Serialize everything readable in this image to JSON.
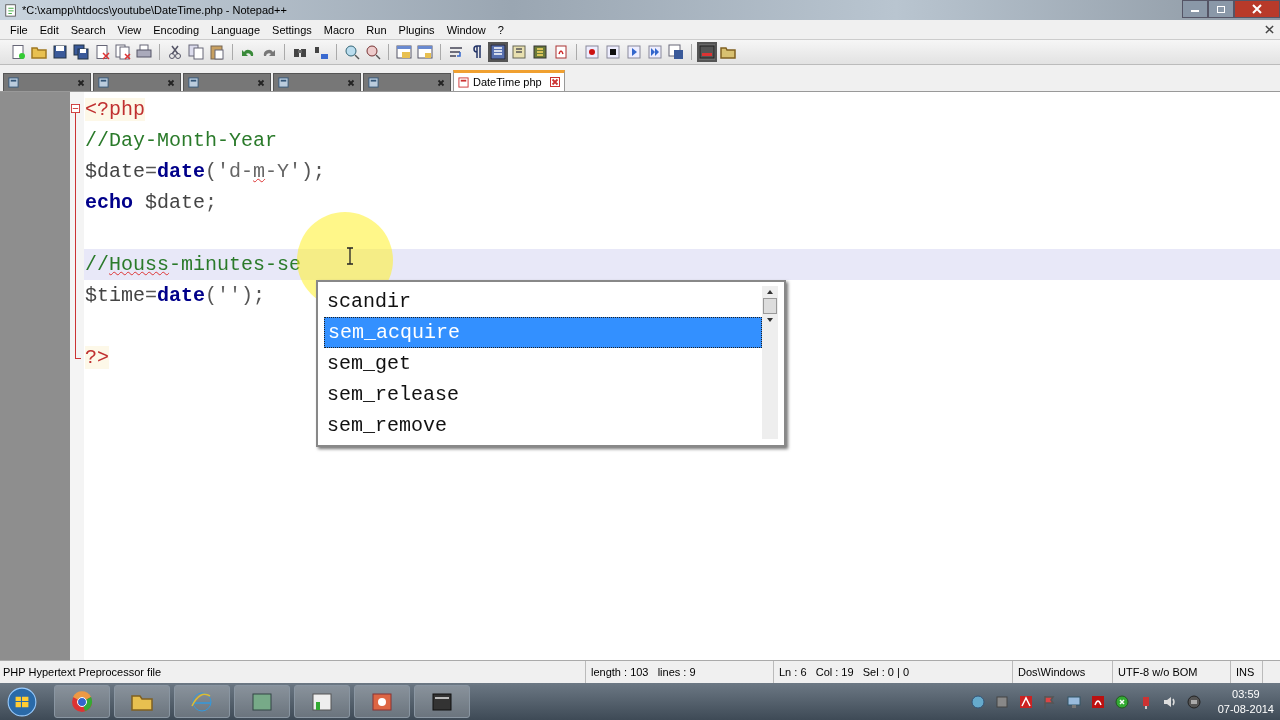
{
  "window": {
    "title": "*C:\\xampp\\htdocs\\youtube\\DateTime.php - Notepad++"
  },
  "menu": [
    "File",
    "Edit",
    "Search",
    "View",
    "Encoding",
    "Language",
    "Settings",
    "Macro",
    "Run",
    "Plugins",
    "Window",
    "?"
  ],
  "tabs": [
    {
      "selected": false
    },
    {
      "selected": false
    },
    {
      "selected": false
    },
    {
      "selected": false
    },
    {
      "selected": false
    },
    {
      "label": "DateTime php",
      "selected": true
    }
  ],
  "lines": [
    {
      "current": false,
      "tokens": [
        {
          "text": "<?php",
          "kind": "tag"
        }
      ]
    },
    {
      "current": false,
      "tokens": [
        {
          "text": "//Day-Month-Year",
          "kind": "comment"
        }
      ]
    },
    {
      "current": false,
      "tokens": [
        {
          "text": "$date",
          "kind": "var"
        },
        {
          "text": "=",
          "kind": "op"
        },
        {
          "text": "date",
          "kind": "func"
        },
        {
          "text": "(",
          "kind": "op"
        },
        {
          "text": "'d-",
          "kind": "string"
        },
        {
          "text": "m",
          "kind": "string",
          "misspelled": true
        },
        {
          "text": "-Y'",
          "kind": "string"
        },
        {
          "text": ");",
          "kind": "op"
        }
      ]
    },
    {
      "current": false,
      "tokens": [
        {
          "text": "echo",
          "kind": "func"
        },
        {
          "text": " $date",
          "kind": "var"
        },
        {
          "text": ";",
          "kind": "op"
        }
      ]
    },
    {
      "current": false
    },
    {
      "current": true,
      "tokens": [
        {
          "text": "//",
          "kind": "comment"
        },
        {
          "text": "Houss",
          "kind": "comment",
          "misspelled": true
        },
        {
          "text": "-minutes-se",
          "kind": "comment"
        }
      ]
    },
    {
      "current": false,
      "tokens": [
        {
          "text": "$time",
          "kind": "var"
        },
        {
          "text": "=",
          "kind": "op"
        },
        {
          "text": "date",
          "kind": "func"
        },
        {
          "text": "(",
          "kind": "op"
        },
        {
          "text": "''",
          "kind": "string"
        },
        {
          "text": ");",
          "kind": "op"
        }
      ]
    },
    {
      "current": false
    },
    {
      "current": false,
      "tokens": [
        {
          "text": "?>",
          "kind": "tag"
        }
      ]
    }
  ],
  "autocomplete": [
    {
      "label": "scandir",
      "selected": false
    },
    {
      "label": "sem_acquire",
      "selected": true
    },
    {
      "label": "sem_get",
      "selected": false
    },
    {
      "label": "sem_release",
      "selected": false
    },
    {
      "label": "sem_remove",
      "selected": false
    }
  ],
  "status_bar": [
    "PHP Hypertext Preprocessor file",
    "length : 103   lines : 9",
    "Ln : 6   Col : 19   Sel : 0 | 0",
    "Dos\\Windows",
    "UTF-8 w/o BOM",
    "INS"
  ],
  "clock": {
    "time": "03:59",
    "date": "07-08-2014"
  }
}
